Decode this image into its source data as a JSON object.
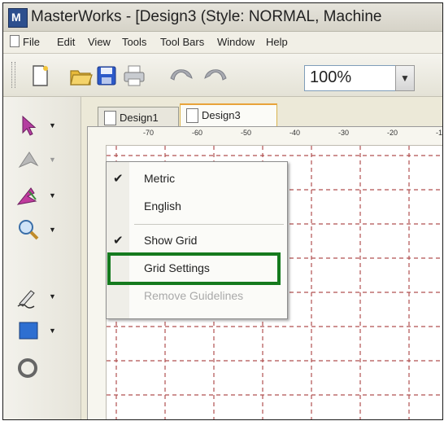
{
  "window": {
    "title": "MasterWorks - [Design3 (Style: NORMAL, Machine"
  },
  "menubar": {
    "items": [
      "File",
      "Edit",
      "View",
      "Tools",
      "Tool Bars",
      "Window",
      "Help"
    ]
  },
  "toolbar": {
    "zoom_value": "100%",
    "buttons": [
      "new-document-icon",
      "open-folder-icon",
      "save-disk-icon",
      "print-icon",
      "undo-icon",
      "redo-icon"
    ]
  },
  "left_toolbar": {
    "tools": [
      "select-arrow-icon",
      "stitch-tool-icon",
      "pointer-stitch-icon",
      "zoom-magnifier-icon",
      "pen-draw-icon",
      "fill-color-icon",
      "rotate-icon"
    ]
  },
  "tabs": [
    {
      "label": "Design1",
      "active": false
    },
    {
      "label": "Design3",
      "active": true
    }
  ],
  "ruler": {
    "h_labels": [
      "-70",
      "-60",
      "-50",
      "-40",
      "-30",
      "-20",
      "-1"
    ]
  },
  "context_menu": {
    "items": [
      {
        "label": "Metric",
        "checked": true,
        "disabled": false
      },
      {
        "label": "English",
        "checked": false,
        "disabled": false
      },
      {
        "label": "Show Grid",
        "checked": true,
        "disabled": false
      },
      {
        "label": "Grid Settings",
        "checked": false,
        "disabled": false,
        "highlighted": true
      },
      {
        "label": "Remove Guidelines",
        "checked": false,
        "disabled": true
      }
    ]
  },
  "colors": {
    "grid_line": "#b05050",
    "highlight_box": "#157a1e",
    "brand_icon": "#2d4f8e"
  }
}
